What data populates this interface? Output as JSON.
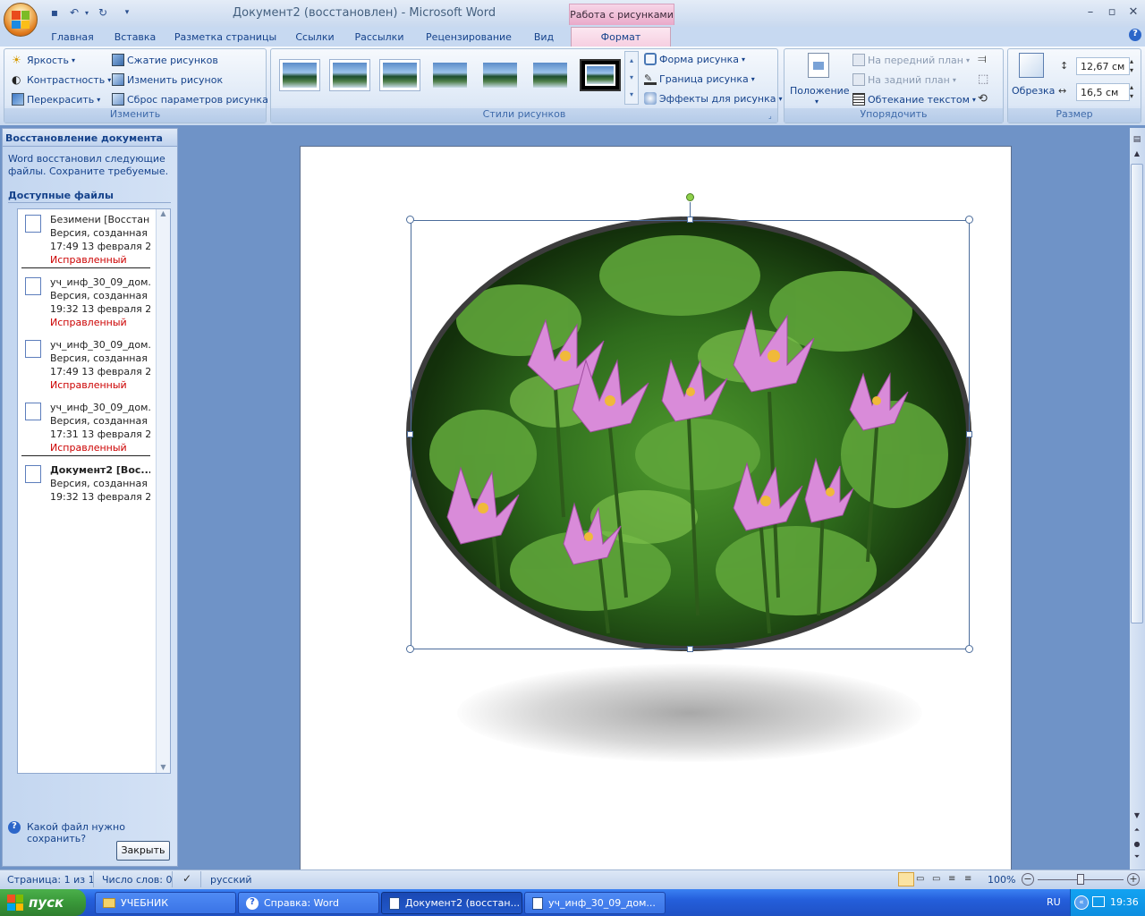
{
  "window": {
    "title": "Документ2 (восстановлен) - Microsoft Word",
    "context_tab_group": "Работа с рисунками"
  },
  "ribbon_tabs": [
    "Главная",
    "Вставка",
    "Разметка страницы",
    "Ссылки",
    "Рассылки",
    "Рецензирование",
    "Вид",
    "Формат"
  ],
  "ribbon": {
    "adjust": {
      "name": "Изменить",
      "brightness": "Яркость",
      "contrast": "Контрастность",
      "recolor": "Перекрасить",
      "compress": "Сжатие рисунков",
      "change": "Изменить рисунок",
      "reset": "Сброс параметров рисунка"
    },
    "styles": {
      "name": "Стили рисунков",
      "shape": "Форма рисунка",
      "border": "Граница рисунка",
      "effects": "Эффекты для рисунка"
    },
    "arrange": {
      "name": "Упорядочить",
      "position": "Положение",
      "front": "На передний план",
      "back": "На задний план",
      "wrap": "Обтекание текстом"
    },
    "size": {
      "name": "Размер",
      "crop": "Обрезка",
      "height": "12,67 см",
      "width": "16,5 см"
    }
  },
  "recovery_pane": {
    "title": "Восстановление документа",
    "message_line1": "Word восстановил следующие",
    "message_line2": "файлы.  Сохраните требуемые.",
    "available": "Доступные файлы",
    "files": [
      {
        "name": "Безимени  [Восстан...",
        "line2": "Версия, созданная ...",
        "line3": "17:49 13 февраля 2...",
        "status": "Исправленный"
      },
      {
        "name": "уч_инф_30_09_дом...",
        "line2": "Версия, созданная ...",
        "line3": "19:32 13 февраля 2...",
        "status": "Исправленный"
      },
      {
        "name": "уч_инф_30_09_дом...",
        "line2": "Версия, созданная ...",
        "line3": "17:49 13 февраля 2...",
        "status": "Исправленный"
      },
      {
        "name": "уч_инф_30_09_дом...",
        "line2": "Версия, созданная ...",
        "line3": "17:31 13 февраля 2...",
        "status": "Исправленный"
      },
      {
        "name": "Документ2  [Вос...",
        "line2": "Версия, созданная ...",
        "line3": "19:32 13 февраля 2...",
        "status": ""
      }
    ],
    "help_link": "Какой файл нужно сохранить?",
    "close_button": "Закрыть"
  },
  "statusbar": {
    "page": "Страница: 1 из 1",
    "words": "Число слов: 0",
    "language": "русский",
    "zoom": "100%"
  },
  "taskbar": {
    "start": "пуск",
    "buttons": [
      "УЧЕБНИК",
      "Справка: Word",
      "Документ2 (восстан...",
      "уч_инф_30_09_дом..."
    ],
    "lang": "RU",
    "time": "19:36"
  },
  "colors": {
    "accent": "#15428b",
    "ribbon": "#dbe6f6",
    "context": "#f6cfe1",
    "taskbar": "#245edb"
  }
}
